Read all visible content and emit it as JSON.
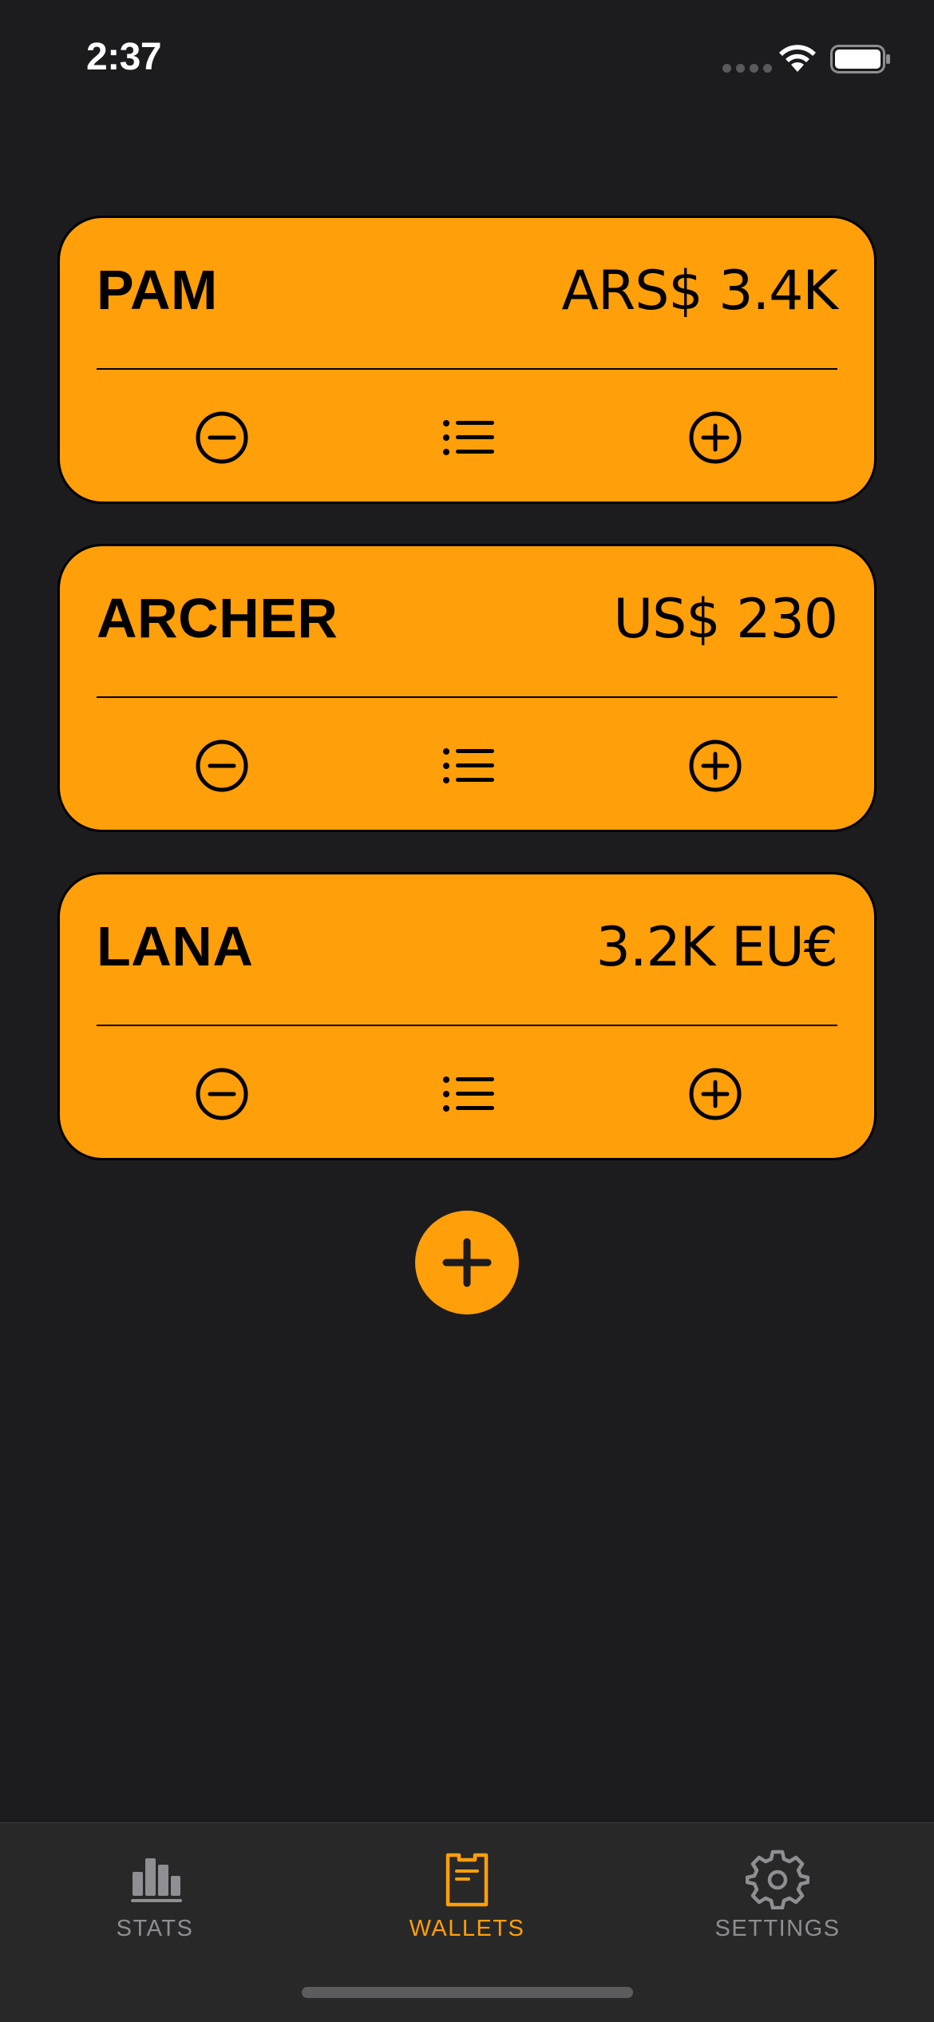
{
  "status_bar": {
    "time": "2:37",
    "icons": [
      "signal-dots-icon",
      "wifi-icon",
      "battery-icon"
    ]
  },
  "colors": {
    "background": "#1c1c1e",
    "accent": "#ff9f0a",
    "tab_bar": "#282828",
    "inactive": "#8e8e93"
  },
  "wallets": [
    {
      "name": "PAM",
      "balance": "ARS$ 3.4K"
    },
    {
      "name": "ARCHER",
      "balance": "US$ 230"
    },
    {
      "name": "LANA",
      "balance": "3.2K EU€"
    }
  ],
  "wallet_actions": [
    "minus-circle-icon",
    "list-icon",
    "plus-circle-icon"
  ],
  "add_wallet": {
    "icon": "plus-icon"
  },
  "tab_bar": {
    "tabs": [
      {
        "label": "STATS",
        "icon": "bar-chart-icon",
        "active": false
      },
      {
        "label": "WALLETS",
        "icon": "wallet-icon",
        "active": true
      },
      {
        "label": "SETTINGS",
        "icon": "gear-icon",
        "active": false
      }
    ]
  }
}
